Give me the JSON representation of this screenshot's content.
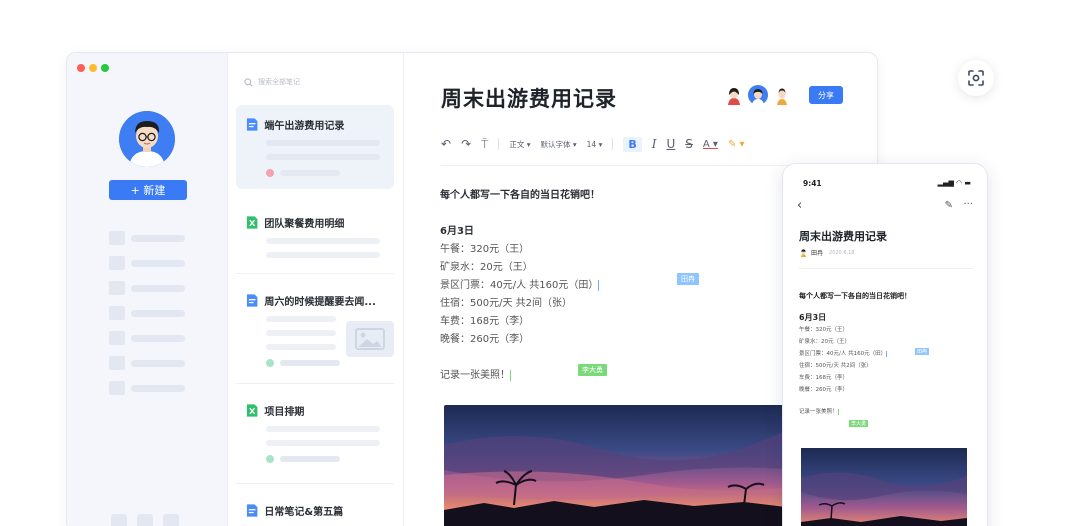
{
  "window": {
    "traffic_lights": [
      "#ff5f57",
      "#febc2e",
      "#28c840"
    ]
  },
  "sidebar": {
    "new_button": "+ 新建",
    "avatar": "user-avatar"
  },
  "search": {
    "placeholder": "搜索全部笔记"
  },
  "doc_list": [
    {
      "title": "端午出游费用记录",
      "type": "doc",
      "active": true
    },
    {
      "title": "团队聚餐费用明细",
      "type": "sheet"
    },
    {
      "title": "周六的时候提醒要去闻...",
      "type": "doc"
    },
    {
      "title": "项目排期",
      "type": "sheet"
    },
    {
      "title": "日常笔记&第五篇",
      "type": "doc"
    }
  ],
  "editor": {
    "title": "周末出游费用记录",
    "share_label": "分享",
    "toolbar": {
      "style": "正文 ▾",
      "font": "默认字体 ▾",
      "size": "14 ▾",
      "bold": "B",
      "italic": "I",
      "underline": "U",
      "strike": "S",
      "color": "A ▾",
      "highlight": "✎ ▾"
    },
    "intro": "每个人都写一下各自的当日花销吧！",
    "date": "6月3日",
    "items": [
      "午餐：320元（王）",
      "矿泉水：20元（王）",
      "景区门票：40元/人 共160元（田）",
      "住宿：500元/天 共2间（张）",
      "车费：168元（李）",
      "晚餐：260元（李）"
    ],
    "photo_note": "记录一张美照！",
    "cursor_tags": {
      "blue": "田冉",
      "green": "李大勇"
    }
  },
  "phone": {
    "time": "9:41",
    "signal": "▂▄▆ ◠ ▬",
    "title": "周末出游费用记录",
    "author": "田冉",
    "edit_time": "2020.6.18",
    "intro": "每个人都写一下各自的当日花销吧！",
    "date": "6月3日",
    "items": [
      "午餐：320元（王）",
      "矿泉水：20元（王）",
      "景区门票：40元/人 共160元（田）",
      "住宿：500元/天 共2间（张）",
      "车费：168元（李）",
      "晚餐：260元（李）"
    ],
    "photo_note": "记录一张美照！",
    "cursor_tags": {
      "blue": "田冉",
      "green": "李大勇"
    }
  },
  "colors": {
    "accent": "#3a7af5",
    "doc_icon": "#4a8cf7",
    "sheet_icon": "#2fbf6b"
  }
}
